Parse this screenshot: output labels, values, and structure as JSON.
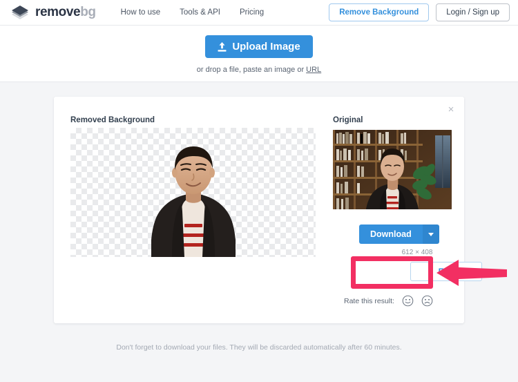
{
  "header": {
    "logo": {
      "icon": "layers-icon",
      "text_dark": "remove",
      "text_gray": "bg"
    },
    "nav": [
      {
        "label": "How to use"
      },
      {
        "label": "Tools & API"
      },
      {
        "label": "Pricing"
      }
    ],
    "actions": {
      "remove_background": "Remove Background",
      "login_signup": "Login / Sign up"
    }
  },
  "upload": {
    "button_label": "Upload Image",
    "button_icon": "upload-icon",
    "hint_prefix": "or drop a file, paste an image or ",
    "hint_link": "URL"
  },
  "card": {
    "close_icon": "×",
    "removed_title": "Removed Background",
    "original_title": "Original",
    "download_label": "Download",
    "download_caret_icon": "chevron-down-icon",
    "dimensions": "612 × 408",
    "edit_label": "Edit",
    "rate_label": "Rate this result:",
    "rate_positive_icon": "smiley-face-icon",
    "rate_negative_icon": "frowny-face-icon"
  },
  "annotations": {
    "highlight_color": "#f22f62",
    "highlight_target": "edit-button",
    "arrow_direction": "left"
  },
  "footer": {
    "note": "Don't forget to download your files. They will be discarded automatically after 60 minutes."
  },
  "colors": {
    "accent_blue": "#3490dc",
    "page_background": "#f4f5f7",
    "annotation_pink": "#f22f62"
  }
}
